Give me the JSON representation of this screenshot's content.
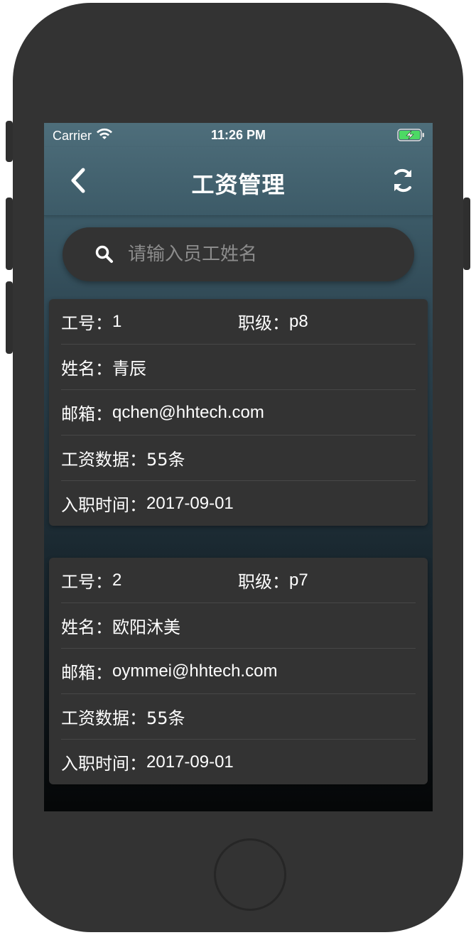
{
  "status_bar": {
    "carrier": "Carrier",
    "time": "11:26 PM"
  },
  "nav": {
    "title": "工资管理",
    "back_icon": "chevron-left-icon",
    "refresh_icon": "refresh-icon"
  },
  "search": {
    "placeholder": "请输入员工姓名",
    "value": ""
  },
  "employees": [
    {
      "id_label": "工号：",
      "id": "1",
      "level_label": "职级：",
      "level": "p8",
      "name_label": "姓名：",
      "name": "青辰",
      "email_label": "邮箱：",
      "email": "qchen@hhtech.com",
      "salary_label": "工资数据：",
      "salary_count": "55条",
      "hire_label": "入职时间：",
      "hire_date": "2017-09-01"
    },
    {
      "id_label": "工号：",
      "id": "2",
      "level_label": "职级：",
      "level": "p7",
      "name_label": "姓名：",
      "name": "欧阳沐美",
      "email_label": "邮箱：",
      "email": "oymmei@hhtech.com",
      "salary_label": "工资数据：",
      "salary_count": "55条",
      "hire_label": "入职时间：",
      "hire_date": "2017-09-01"
    }
  ],
  "colors": {
    "nav_bg": "#4e6e7b",
    "card_bg": "#333333",
    "text": "#ffffff",
    "placeholder": "#8c8c8c"
  }
}
